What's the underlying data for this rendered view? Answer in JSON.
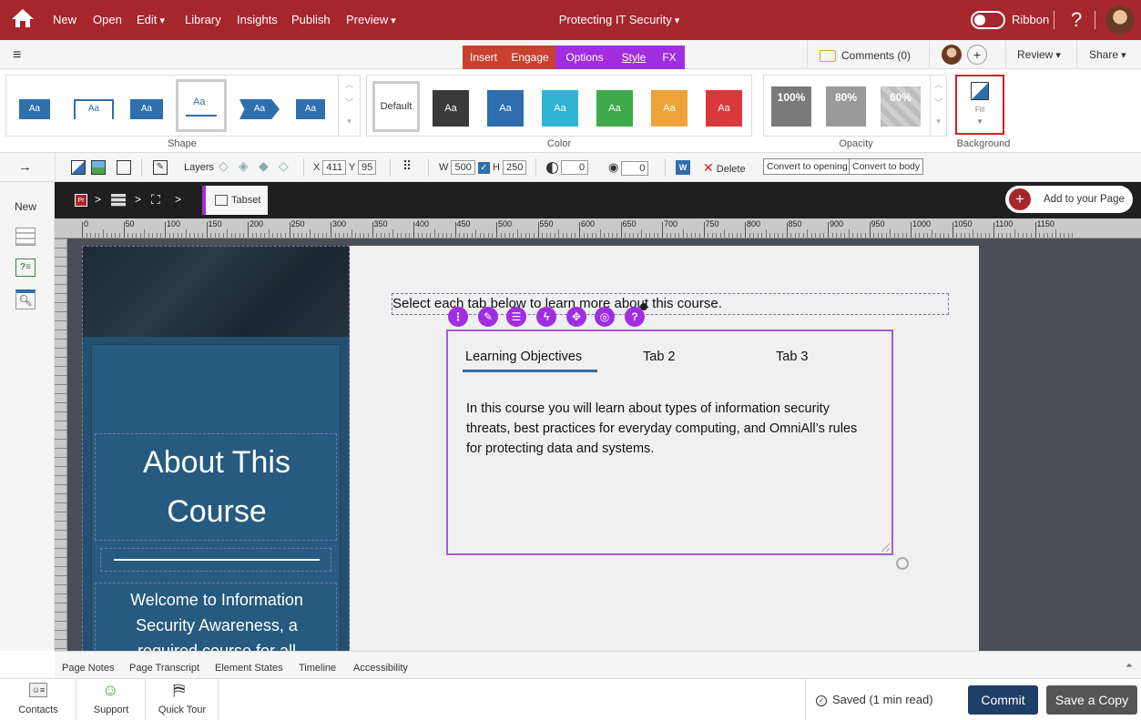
{
  "topbar": {
    "menu": {
      "new": "New",
      "open": "Open",
      "edit": "Edit",
      "library": "Library",
      "insights": "Insights",
      "publish": "Publish",
      "preview": "Preview"
    },
    "title": "Protecting IT Security",
    "ribbon_label": "Ribbon",
    "help": "?"
  },
  "bar2": {
    "tabs": {
      "insert": "Insert",
      "engage": "Engage",
      "options": "Options",
      "style": "Style",
      "fx": "FX"
    },
    "comments": "Comments (0)",
    "review": "Review",
    "share": "Share"
  },
  "ribbon": {
    "shape_label": "Shape",
    "color_label": "Color",
    "opacity_label": "Opacity",
    "background_label": "Background",
    "fill_label": "Fill",
    "shape_sample": "Aa",
    "color_default": "Default",
    "color_swatches": [
      "#3a3a3a",
      "#2f6fad",
      "#2fb4d6",
      "#3faa4c",
      "#f0a23a",
      "#d9393b"
    ],
    "opacity_values": [
      "100%",
      "80%",
      "60%"
    ]
  },
  "toolbar3": {
    "layers": "Layers",
    "x_label": "X",
    "x_value": "411",
    "y_label": "Y",
    "y_value": "95",
    "w_label": "W",
    "w_value": "500",
    "h_label": "H",
    "h_value": "250",
    "rotation": "0",
    "opacity": "0",
    "delete": "Delete",
    "convert_opening": "Convert to opening",
    "convert_body": "Convert to body"
  },
  "leftside": {
    "new": "New"
  },
  "crumbs": {
    "current": "Tabset",
    "add_to_page": "Add to your Page",
    "sep": ">"
  },
  "ruler": {
    "marks": [
      "0",
      "50",
      "100",
      "150",
      "200",
      "250",
      "300",
      "350",
      "400",
      "450",
      "500",
      "550",
      "600",
      "650",
      "700",
      "750",
      "800",
      "850",
      "900",
      "950",
      "1000",
      "1050",
      "1100",
      "1150"
    ]
  },
  "page": {
    "instruction": "Select each tab below to learn more about this course.",
    "left_title": "About This Course",
    "left_body": "Welcome to Information Security Awareness, a required course for all OmniAll",
    "tabs": [
      "Learning Objectives",
      "Tab 2",
      "Tab 3"
    ],
    "tab_content": "In this course you will learn about types of information security threats, best practices for everyday computing, and OmniAll’s rules for protecting data and systems."
  },
  "bottom_tabs": [
    "Page Notes",
    "Page Transcript",
    "Element States",
    "Timeline",
    "Accessibility"
  ],
  "footer": {
    "contacts": "Contacts",
    "support": "Support",
    "quick_tour": "Quick Tour",
    "saved": "Saved (1 min read)",
    "commit": "Commit",
    "save_copy": "Save a Copy"
  },
  "colors": {
    "brand": "#a6262d",
    "accent_purple": "#a02ee0",
    "commit": "#1f3f66",
    "save_copy": "#555555"
  }
}
